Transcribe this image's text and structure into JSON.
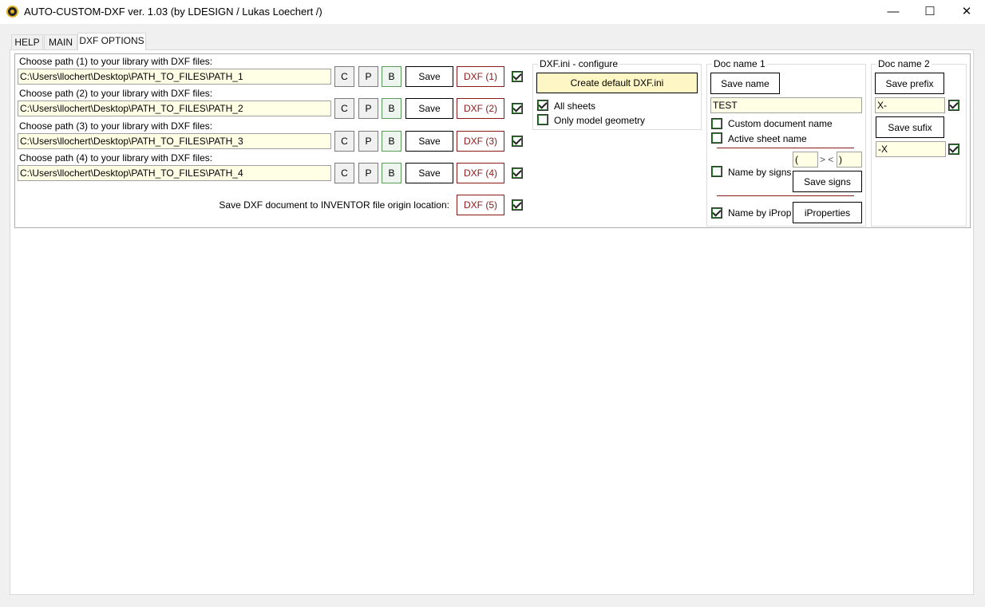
{
  "window": {
    "title": "AUTO-CUSTOM-DXF ver. 1.03 (by LDESIGN / Lukas Loechert /)",
    "minimize": "—",
    "maximize": "☐",
    "close": "✕"
  },
  "tabs": [
    {
      "label": "HELP"
    },
    {
      "label": "MAIN"
    },
    {
      "label": "DXF OPTIONS",
      "selected": true
    }
  ],
  "paths": [
    {
      "label": "Choose path (1) to your library with DXF files:",
      "value": "C:\\Users\\llochert\\Desktop\\PATH_TO_FILES\\PATH_1",
      "c": "C",
      "p": "P",
      "b": "B",
      "save": "Save",
      "dxf": "DXF (1)",
      "checked": true
    },
    {
      "label": "Choose path (2) to your library with DXF files:",
      "value": "C:\\Users\\llochert\\Desktop\\PATH_TO_FILES\\PATH_2",
      "c": "C",
      "p": "P",
      "b": "B",
      "save": "Save",
      "dxf": "DXF (2)",
      "checked": true
    },
    {
      "label": "Choose path (3) to your library with DXF files:",
      "value": "C:\\Users\\llochert\\Desktop\\PATH_TO_FILES\\PATH_3",
      "c": "C",
      "p": "P",
      "b": "B",
      "save": "Save",
      "dxf": "DXF (3)",
      "checked": true
    },
    {
      "label": "Choose path (4) to your library with DXF files:",
      "value": "C:\\Users\\llochert\\Desktop\\PATH_TO_FILES\\PATH_4",
      "c": "C",
      "p": "P",
      "b": "B",
      "save": "Save",
      "dxf": "DXF (4)",
      "checked": true
    }
  ],
  "origin": {
    "label": "Save DXF document to INVENTOR file origin location:",
    "dxf": "DXF (5)",
    "checked": true
  },
  "dxfini": {
    "title": "DXF.ini - configure",
    "create": "Create default DXF.ini",
    "all_sheets": "All sheets",
    "all_sheets_checked": true,
    "only_model": "Only model geometry",
    "only_model_checked": false
  },
  "doc1": {
    "title": "Doc name 1",
    "save_name": "Save name",
    "name_value": "TEST",
    "custom": "Custom document name",
    "active": "Active sheet name",
    "signs_open": "(",
    "signs_sep": "> <",
    "signs_close": ")",
    "by_signs": "Name by signs",
    "save_signs": "Save signs",
    "by_iprop": "Name by iProp",
    "by_iprop_checked": true,
    "iproperties": "iProperties"
  },
  "doc2": {
    "title": "Doc name 2",
    "save_prefix": "Save prefix",
    "prefix_value": "X-",
    "prefix_checked": true,
    "save_sufix": "Save sufix",
    "sufix_value": "-X",
    "sufix_checked": true
  }
}
